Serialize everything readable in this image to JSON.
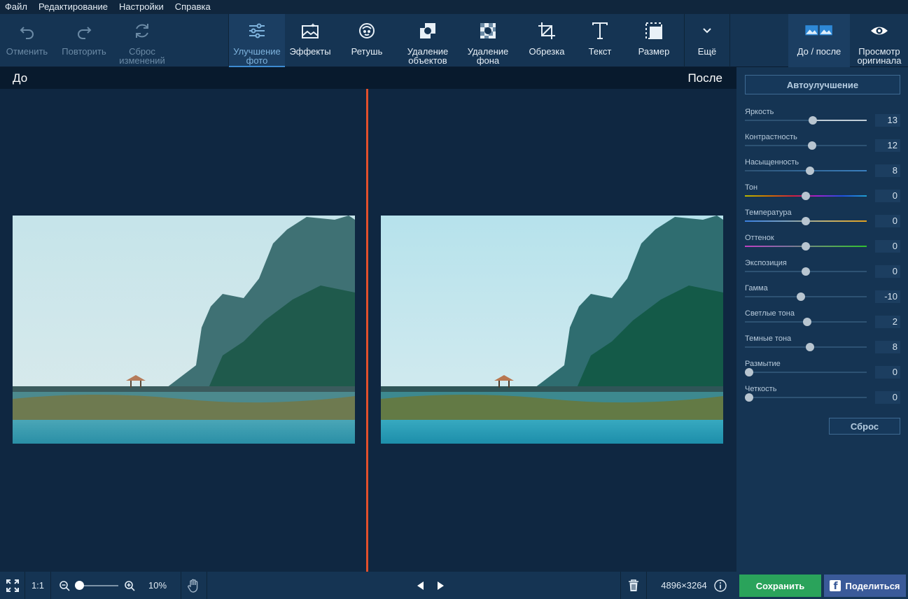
{
  "menu": [
    "Файл",
    "Редактирование",
    "Настройки",
    "Справка"
  ],
  "toolbar": {
    "undo": "Отменить",
    "redo": "Повторить",
    "reset": "Сброс\nизменений",
    "enhance": "Улучшение\nфото",
    "effects": "Эффекты",
    "retouch": "Ретушь",
    "remove_objects": "Удаление\nобъектов",
    "remove_bg": "Удаление\nфона",
    "crop": "Обрезка",
    "text": "Текст",
    "resize": "Размер",
    "more": "Ещё",
    "before_after": "До / после",
    "view_original": "Просмотр\nоригинала"
  },
  "compare": {
    "before": "До",
    "after": "После"
  },
  "panel": {
    "auto": "Автоулучшение",
    "reset": "Сброс",
    "sliders": [
      {
        "name": "Яркость",
        "value": "13",
        "pos": 0.56
      },
      {
        "name": "Контрастность",
        "value": "12",
        "pos": 0.555
      },
      {
        "name": "Насыщенность",
        "value": "8",
        "pos": 0.535
      },
      {
        "name": "Тон",
        "value": "0",
        "pos": 0.5
      },
      {
        "name": "Температура",
        "value": "0",
        "pos": 0.5
      },
      {
        "name": "Оттенок",
        "value": "0",
        "pos": 0.5
      },
      {
        "name": "Экспозиция",
        "value": "0",
        "pos": 0.5
      },
      {
        "name": "Гамма",
        "value": "-10",
        "pos": 0.455
      },
      {
        "name": "Светлые тона",
        "value": "2",
        "pos": 0.51
      },
      {
        "name": "Темные тона",
        "value": "8",
        "pos": 0.535
      },
      {
        "name": "Размытие",
        "value": "0",
        "pos": 0.0
      },
      {
        "name": "Четкость",
        "value": "0",
        "pos": 0.0
      }
    ]
  },
  "status": {
    "one_to_one": "1:1",
    "zoom": "10%",
    "zoom_level": 0.0,
    "resolution": "4896×3264",
    "save": "Сохранить",
    "share": "Поделиться"
  },
  "colors": {
    "accent": "#e2502c",
    "save": "#2aa35b",
    "share": "#3a5a99"
  }
}
